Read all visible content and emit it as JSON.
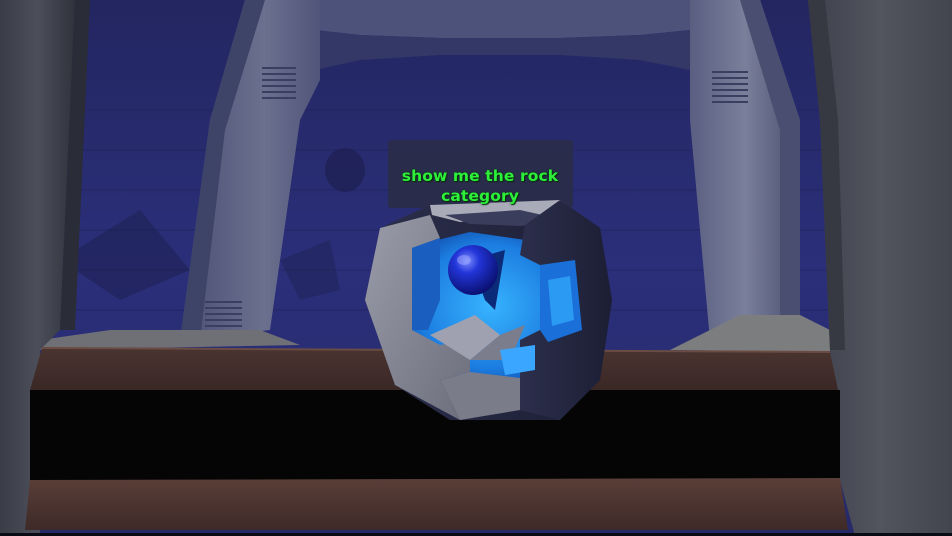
{
  "scene": {
    "caption": "show me the rock category",
    "object": "sphere-in-cube-frame",
    "colors": {
      "caption": "#2cf03a",
      "sky": "#262a6e",
      "frame": "#8a8c98",
      "inner_glow": "#1f8fe8",
      "sphere": "#1a2dd0"
    }
  }
}
